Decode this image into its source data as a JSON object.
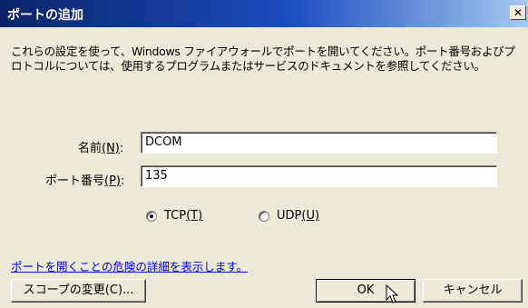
{
  "window": {
    "title": "ポートの追加",
    "close_glyph": "✕"
  },
  "description": {
    "line1": "これらの設定を使って、Windows ファイアウォールでポートを開いてください。ポート番号およびプ",
    "line2": "ロトコルについては、使用するプログラムまたはサービスのドキュメントを参照してください。"
  },
  "name_field": {
    "label": "名前",
    "accelerator": "(N)",
    "suffix": ":",
    "value": "DCOM"
  },
  "port_field": {
    "label": "ポート番号",
    "accelerator": "(P)",
    "suffix": ":",
    "value": "135"
  },
  "protocol": {
    "options": [
      {
        "label": "TCP",
        "accelerator": "(T)",
        "selected": true
      },
      {
        "label": "UDP",
        "accelerator": "(U)",
        "selected": false
      }
    ]
  },
  "risk_link": "ポートを開くことの危険の詳細を表示します。",
  "buttons": {
    "scope": "スコープの変更(C)...",
    "ok": "OK",
    "cancel": "キャンセル"
  },
  "icons": {
    "close": "close-icon",
    "cursor": "arrow-cursor-icon"
  }
}
